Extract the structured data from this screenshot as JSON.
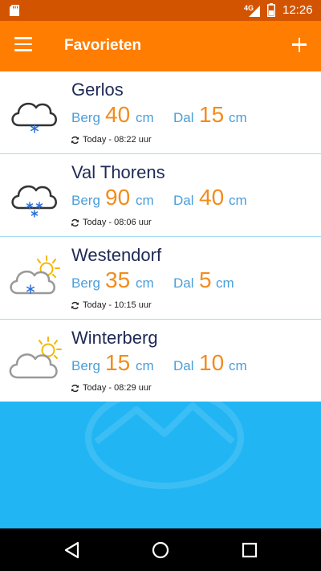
{
  "status_bar": {
    "network": "4G",
    "time": "12:26"
  },
  "app_bar": {
    "title": "Favorieten",
    "menu_icon": "hamburger-menu-icon",
    "add_icon": "plus-icon"
  },
  "labels": {
    "berg": "Berg",
    "dal": "Dal",
    "unit": "cm"
  },
  "resorts": [
    {
      "name": "Gerlos",
      "berg": "40",
      "dal": "15",
      "updated": "Today - 08:22 uur",
      "weather_icon": "cloud-snow-icon"
    },
    {
      "name": "Val Thorens",
      "berg": "90",
      "dal": "40",
      "updated": "Today - 08:06 uur",
      "weather_icon": "cloud-heavy-snow-icon"
    },
    {
      "name": "Westendorf",
      "berg": "35",
      "dal": "5",
      "updated": "Today - 10:15 uur",
      "weather_icon": "sun-cloud-snow-icon"
    },
    {
      "name": "Winterberg",
      "berg": "15",
      "dal": "10",
      "updated": "Today - 08:29 uur",
      "weather_icon": "sun-cloud-icon"
    }
  ],
  "colors": {
    "status_bar": "#d35400",
    "app_bar": "#ff7d00",
    "resort_name": "#1e2a55",
    "label_blue": "#4a9ed9",
    "value_orange": "#f28c1d",
    "backdrop": "#21b5f4"
  }
}
